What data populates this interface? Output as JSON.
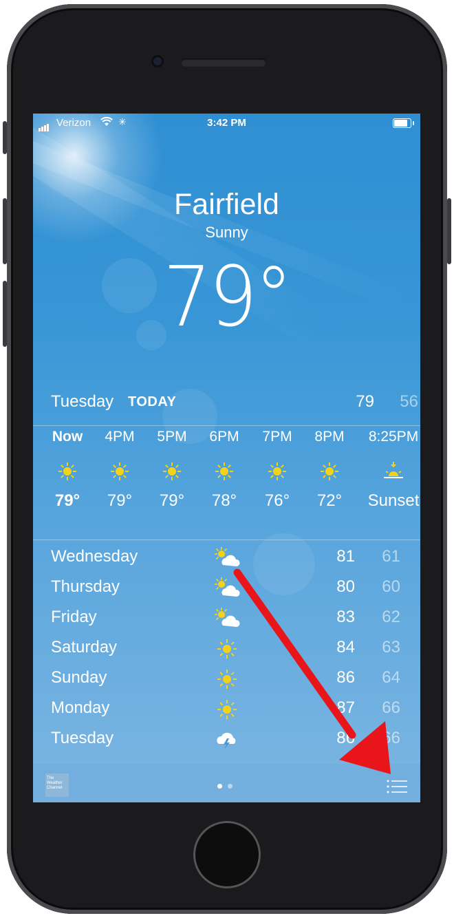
{
  "status_bar": {
    "carrier": "Verizon",
    "time": "3:42 PM"
  },
  "location": {
    "city": "Fairfield",
    "condition": "Sunny",
    "temperature": "79°"
  },
  "today": {
    "day": "Tuesday",
    "label": "TODAY",
    "high": "79",
    "low": "56"
  },
  "hourly": [
    {
      "time": "Now",
      "icon": "sun-icon",
      "value": "79°"
    },
    {
      "time": "4PM",
      "icon": "sun-icon",
      "value": "79°"
    },
    {
      "time": "5PM",
      "icon": "sun-icon",
      "value": "79°"
    },
    {
      "time": "6PM",
      "icon": "sun-icon",
      "value": "78°"
    },
    {
      "time": "7PM",
      "icon": "sun-icon",
      "value": "76°"
    },
    {
      "time": "8PM",
      "icon": "sun-icon",
      "value": "72°"
    },
    {
      "time": "8:25PM",
      "icon": "sunset-icon",
      "value": "Sunset"
    }
  ],
  "daily": [
    {
      "day": "Wednesday",
      "icon": "partly-cloudy-icon",
      "high": "81",
      "low": "61"
    },
    {
      "day": "Thursday",
      "icon": "partly-cloudy-icon",
      "high": "80",
      "low": "60"
    },
    {
      "day": "Friday",
      "icon": "partly-cloudy-icon",
      "high": "83",
      "low": "62"
    },
    {
      "day": "Saturday",
      "icon": "sun-icon",
      "high": "84",
      "low": "63"
    },
    {
      "day": "Sunday",
      "icon": "sun-icon",
      "high": "86",
      "low": "64"
    },
    {
      "day": "Monday",
      "icon": "sun-icon",
      "high": "87",
      "low": "66"
    },
    {
      "day": "Tuesday",
      "icon": "thunderstorm-icon",
      "high": "86",
      "low": "66"
    }
  ],
  "footer": {
    "logo_text": "The Weather Channel",
    "pages": 2,
    "active_page": 1
  },
  "colors": {
    "sky_top": "#2f8fd3",
    "sky_bottom": "#7db6e2",
    "sun": "#f5d21a",
    "arrow": "#e8151b"
  }
}
